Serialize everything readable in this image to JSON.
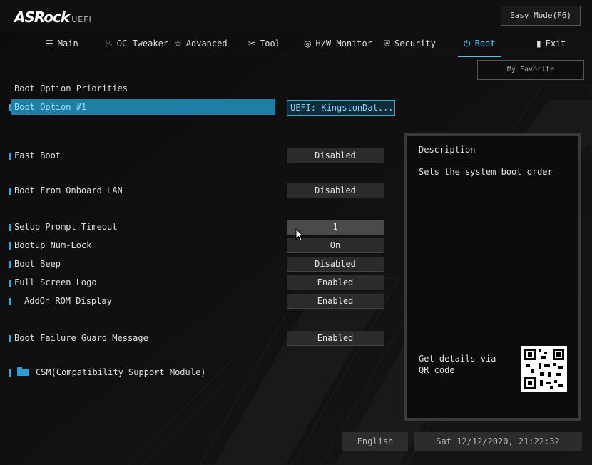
{
  "brand": {
    "name": "ASRock",
    "suffix": "UEFI"
  },
  "easy_mode_label": "Easy Mode(F6)",
  "tabs": [
    {
      "label": "Main",
      "icon": "list-icon"
    },
    {
      "label": "OC Tweaker",
      "icon": "flame-icon"
    },
    {
      "label": "Advanced",
      "icon": "star-icon"
    },
    {
      "label": "Tool",
      "icon": "wrench-icon"
    },
    {
      "label": "H/W Monitor",
      "icon": "monitor-icon"
    },
    {
      "label": "Security",
      "icon": "shield-icon"
    },
    {
      "label": "Boot",
      "icon": "power-icon",
      "active": true
    },
    {
      "label": "Exit",
      "icon": "door-icon"
    }
  ],
  "my_favorite_label": "My Favorite",
  "section_title": "Boot Option Priorities",
  "settings": [
    {
      "label": "Boot Option #1",
      "value": "UEFI: KingstonDat...",
      "selected": true
    },
    {
      "label": "Fast Boot",
      "value": "Disabled"
    },
    {
      "label": "Boot From Onboard LAN",
      "value": "Disabled"
    },
    {
      "label": "Setup Prompt Timeout",
      "value": "1"
    },
    {
      "label": "Bootup Num-Lock",
      "value": "On"
    },
    {
      "label": "Boot Beep",
      "value": "Disabled"
    },
    {
      "label": "Full Screen Logo",
      "value": "Enabled"
    },
    {
      "label": "AddOn ROM Display",
      "value": "Enabled"
    },
    {
      "label": "Boot Failure Guard Message",
      "value": "Enabled"
    },
    {
      "label": "CSM(Compatibility Support Module)",
      "icon": "folder-icon"
    }
  ],
  "description": {
    "title": "Description",
    "text": "Sets the system boot order",
    "qr_text": "Get details via QR code"
  },
  "footer": {
    "language": "English",
    "datetime": "Sat 12/12/2020, 21:22:32"
  },
  "colors": {
    "accent": "#4fc3f7",
    "selection": "#1f7ea3"
  }
}
